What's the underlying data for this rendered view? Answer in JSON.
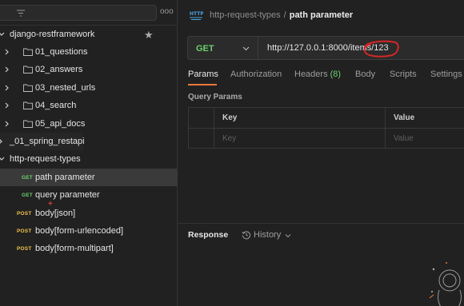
{
  "sidebar": {
    "more_glyph": "ooo",
    "collections": [
      {
        "label": "django-restframework",
        "starred": true
      },
      {
        "label": "01_questions"
      },
      {
        "label": "02_answers"
      },
      {
        "label": "03_nested_urls"
      },
      {
        "label": "04_search"
      },
      {
        "label": "05_api_docs"
      },
      {
        "label": "_01_spring_restapi"
      },
      {
        "label": "http-request-types"
      }
    ],
    "requests": [
      {
        "method": "GET",
        "label": "path parameter",
        "selected": true
      },
      {
        "method": "GET",
        "label": "query parameter"
      },
      {
        "method": "POST",
        "label": "body[json]"
      },
      {
        "method": "POST",
        "label": "body[form-urlencoded]"
      },
      {
        "method": "POST",
        "label": "body[form-multipart]"
      }
    ],
    "cursor_glyph": "+"
  },
  "header": {
    "icon": "http-icon",
    "collection": "http-request-types",
    "separator": "/",
    "request": "path parameter"
  },
  "urlbar": {
    "method": "GET",
    "url": "http://127.0.0.1:8000/items/123"
  },
  "tabs": [
    {
      "label": "Params",
      "active": true
    },
    {
      "label": "Authorization"
    },
    {
      "label": "Headers",
      "count": "(8)"
    },
    {
      "label": "Body"
    },
    {
      "label": "Scripts"
    },
    {
      "label": "Settings"
    }
  ],
  "query_params": {
    "title": "Query Params",
    "columns": {
      "key": "Key",
      "value": "Value"
    },
    "placeholder": {
      "key": "Key",
      "value": "Value"
    }
  },
  "response": {
    "label": "Response",
    "history_label": "History"
  },
  "colors": {
    "get": "#6ccf6c",
    "post": "#f0c24b",
    "accent": "#e8793a",
    "annotation": "#d62626"
  }
}
